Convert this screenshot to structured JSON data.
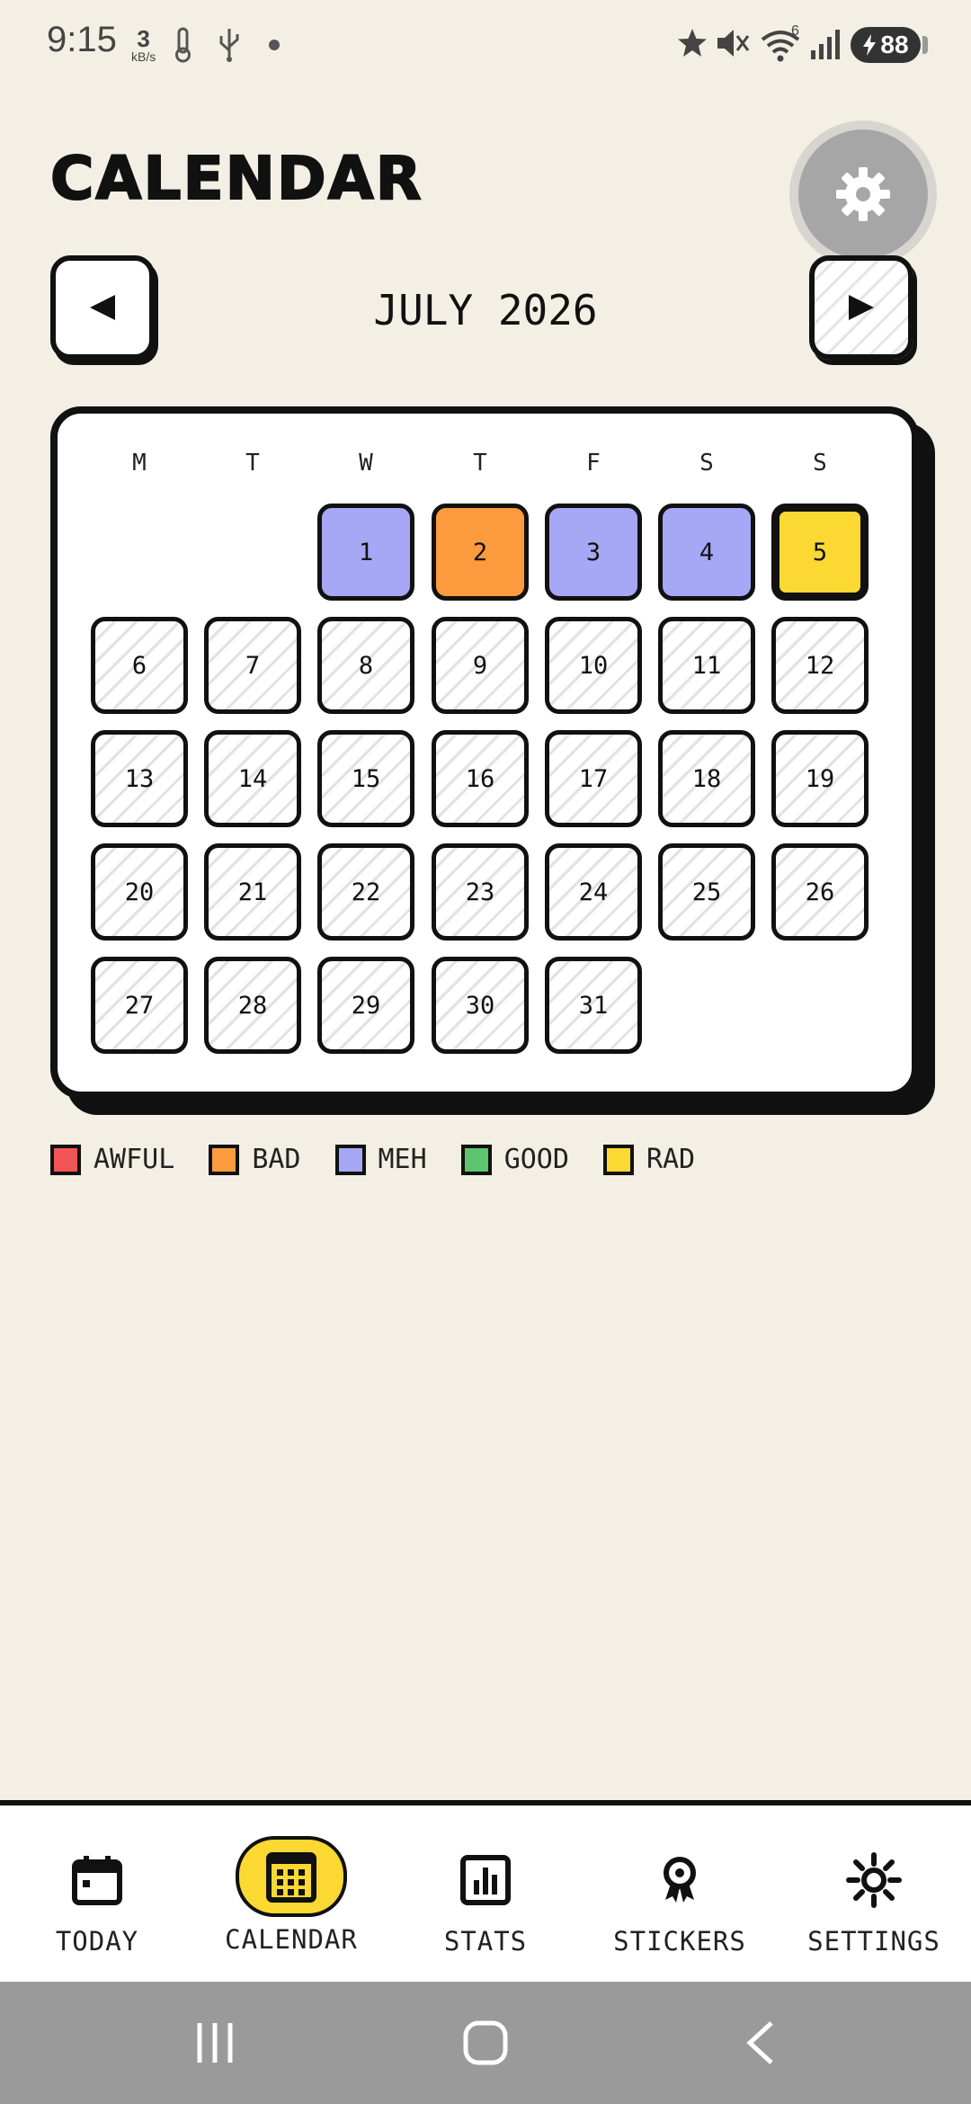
{
  "status_bar": {
    "time": "9:15",
    "net_speed_value": "3",
    "net_speed_unit": "kB/s",
    "wifi_badge": "6",
    "battery": "88"
  },
  "header": {
    "title": "CALENDAR",
    "settings_icon": "gear-icon"
  },
  "month_nav": {
    "prev_label": "◀",
    "next_label": "▶",
    "month_label": "JULY 2026"
  },
  "calendar": {
    "weekdays": [
      "M",
      "T",
      "W",
      "T",
      "F",
      "S",
      "S"
    ],
    "days": [
      {
        "n": "1",
        "mood": "meh"
      },
      {
        "n": "2",
        "mood": "bad"
      },
      {
        "n": "3",
        "mood": "meh"
      },
      {
        "n": "4",
        "mood": "meh"
      },
      {
        "n": "5",
        "mood": "rad"
      },
      {
        "n": "6",
        "mood": "none"
      },
      {
        "n": "7",
        "mood": "none"
      },
      {
        "n": "8",
        "mood": "none"
      },
      {
        "n": "9",
        "mood": "none"
      },
      {
        "n": "10",
        "mood": "none"
      },
      {
        "n": "11",
        "mood": "none"
      },
      {
        "n": "12",
        "mood": "none"
      },
      {
        "n": "13",
        "mood": "none"
      },
      {
        "n": "14",
        "mood": "none"
      },
      {
        "n": "15",
        "mood": "none"
      },
      {
        "n": "16",
        "mood": "none"
      },
      {
        "n": "17",
        "mood": "none"
      },
      {
        "n": "18",
        "mood": "none"
      },
      {
        "n": "19",
        "mood": "none"
      },
      {
        "n": "20",
        "mood": "none"
      },
      {
        "n": "21",
        "mood": "none"
      },
      {
        "n": "22",
        "mood": "none"
      },
      {
        "n": "23",
        "mood": "none"
      },
      {
        "n": "24",
        "mood": "none"
      },
      {
        "n": "25",
        "mood": "none"
      },
      {
        "n": "26",
        "mood": "none"
      },
      {
        "n": "27",
        "mood": "none"
      },
      {
        "n": "28",
        "mood": "none"
      },
      {
        "n": "29",
        "mood": "none"
      },
      {
        "n": "30",
        "mood": "none"
      },
      {
        "n": "31",
        "mood": "none"
      }
    ],
    "first_weekday_index": 2
  },
  "legend": [
    {
      "label": "AWFUL",
      "color": "#f25555"
    },
    {
      "label": "BAD",
      "color": "#fb9b3e"
    },
    {
      "label": "MEH",
      "color": "#a6a7f5"
    },
    {
      "label": "GOOD",
      "color": "#5ec46e"
    },
    {
      "label": "RAD",
      "color": "#fbd832"
    }
  ],
  "bottom_nav": {
    "items": [
      {
        "label": "TODAY",
        "icon": "calendar-day-icon",
        "active": false
      },
      {
        "label": "CALENDAR",
        "icon": "calendar-grid-icon",
        "active": true
      },
      {
        "label": "STATS",
        "icon": "bar-chart-icon",
        "active": false
      },
      {
        "label": "STICKERS",
        "icon": "award-badge-icon",
        "active": false
      },
      {
        "label": "SETTINGS",
        "icon": "sun-gear-icon",
        "active": false
      }
    ]
  },
  "colors": {
    "background": "#f3efe4",
    "accent": "#fbd832",
    "meh": "#a6a7f5",
    "bad": "#fb9b3e",
    "rad": "#fbd832"
  }
}
